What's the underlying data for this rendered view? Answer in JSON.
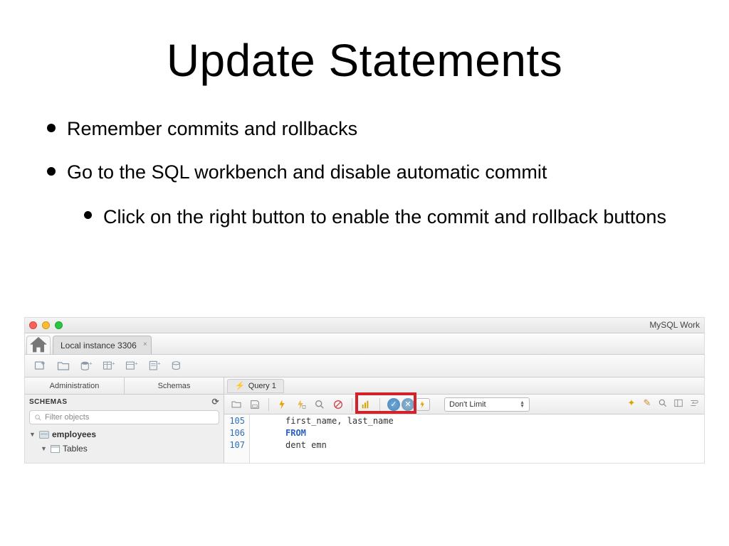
{
  "slide": {
    "title": "Update Statements",
    "bullets": [
      {
        "level": 1,
        "text": "Remember commits and rollbacks"
      },
      {
        "level": 1,
        "text": "Go to the SQL workbench and disable automatic commit"
      },
      {
        "level": 2,
        "text": "Click on the right button to enable the commit and rollback buttons"
      }
    ]
  },
  "workbench": {
    "app_title": "MySQL Work",
    "connection_tab": "Local instance 3306",
    "left_tabs": [
      "Administration",
      "Schemas"
    ],
    "schemas_label": "SCHEMAS",
    "filter_placeholder": "Filter objects",
    "tree": {
      "db": "employees",
      "node": "Tables"
    },
    "query_tab": "Query 1",
    "limit_label": "Don't Limit",
    "gutter": [
      "105",
      "106",
      "107"
    ],
    "code": {
      "line1": "first_name, last_name",
      "line2_keyword": "FROM",
      "line3": "dent emn"
    }
  }
}
